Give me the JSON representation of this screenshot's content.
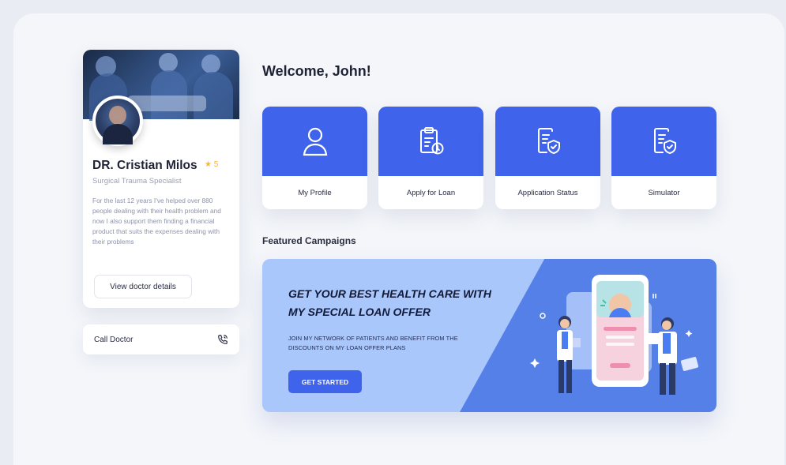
{
  "doctor": {
    "name": "DR. Cristian Milos",
    "rating": "★ 5",
    "specialty": "Surgical Trauma Specialist",
    "bio": "For the last 12 years I've helped over 880 people dealing with their health problem and now I also support them finding a financial product that suits the expenses dealing with their problems",
    "details_button": "View doctor details"
  },
  "call": {
    "label": "Call Doctor",
    "icon": "phone-icon"
  },
  "main": {
    "welcome": "Welcome, John!",
    "tiles": [
      {
        "label": "My Profile",
        "icon": "user-icon"
      },
      {
        "label": "Apply for Loan",
        "icon": "clipboard-clock-icon"
      },
      {
        "label": "Application Status",
        "icon": "document-shield-icon"
      },
      {
        "label": "Simulator",
        "icon": "document-shield-icon"
      }
    ],
    "featured_title": "Featured Campaigns",
    "campaign": {
      "headline": "GET YOUR BEST HEALTH CARE WITH MY SPECIAL LOAN OFFER",
      "body": "JOIN MY NETWORK OF PATIENTS AND BENEFIT FROM THE DISCOUNTS ON MY LOAN OFFER PLANS",
      "cta": "GET STARTED"
    }
  },
  "colors": {
    "accent": "#3f63ea",
    "banner_light": "#a9c7fb",
    "banner_dark": "#5580e8",
    "star": "#f4b73a"
  }
}
